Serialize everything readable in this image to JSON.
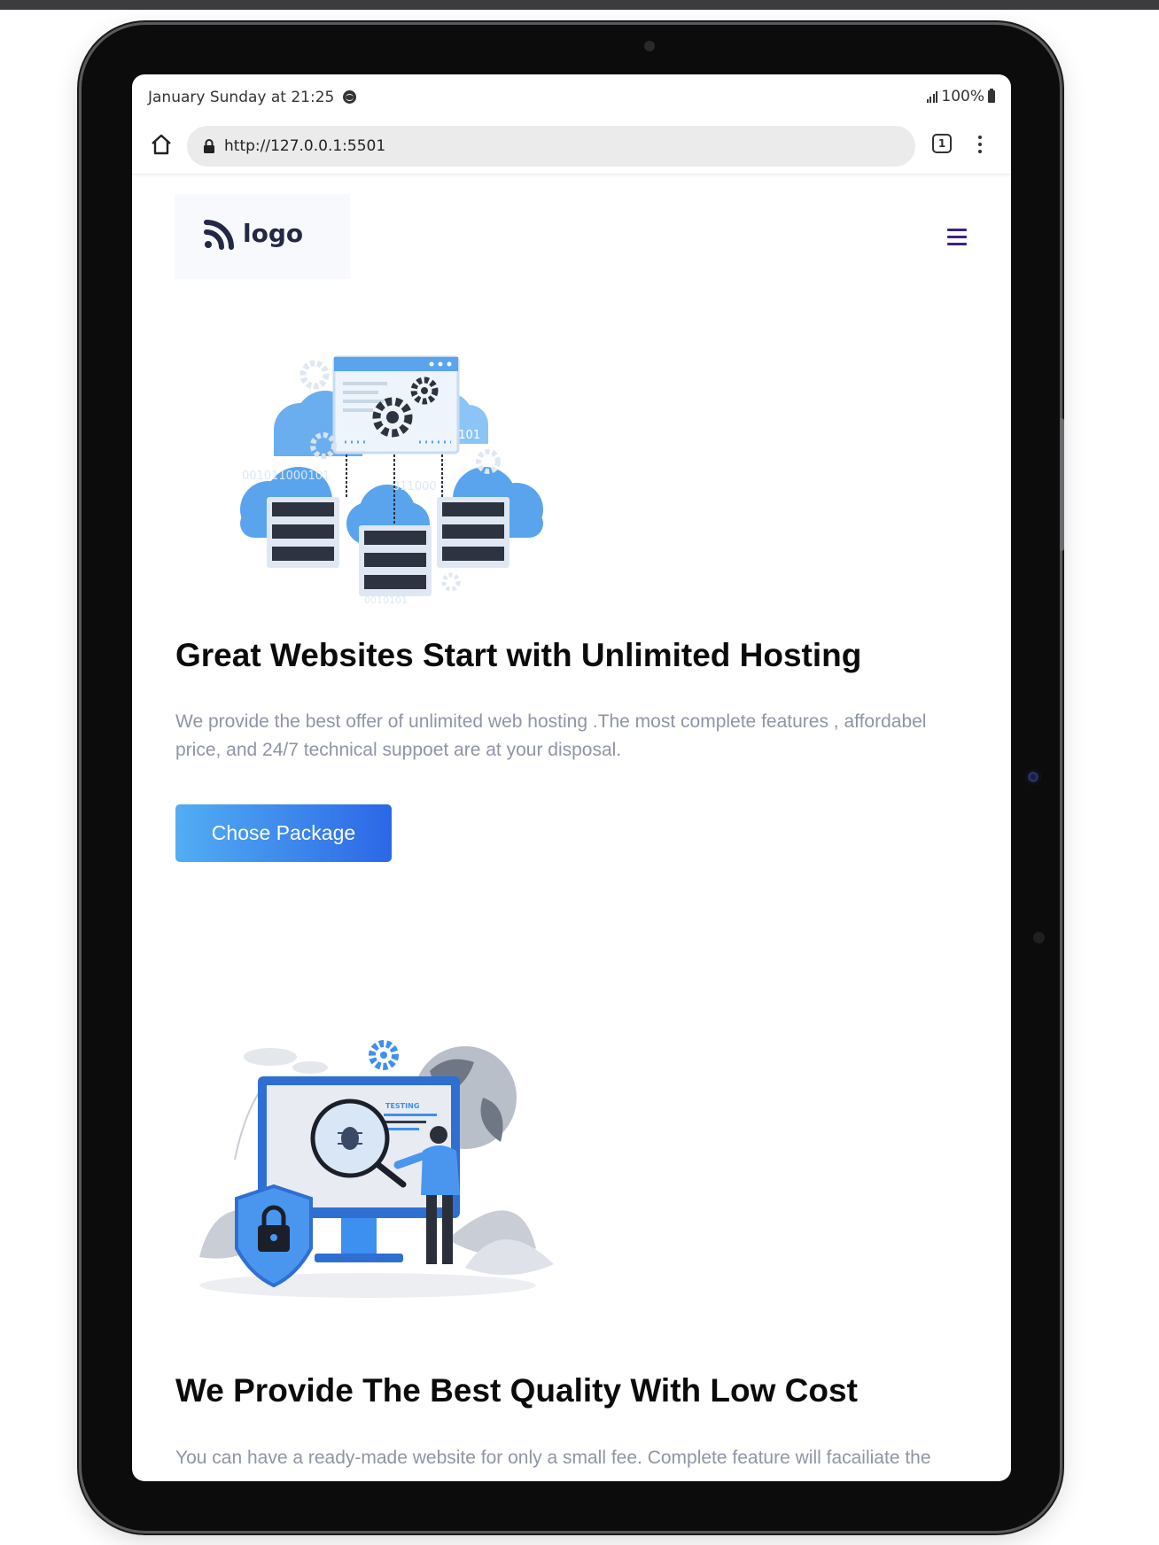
{
  "status_bar": {
    "time_text": "January Sunday at 21:25",
    "battery_text": "100%"
  },
  "browser": {
    "url": "http://127.0.0.1:5501",
    "tab_count": "1"
  },
  "site": {
    "logo_text": "logo",
    "hero": {
      "title": "Great Websites Start with Unlimited Hosting",
      "description": "We provide the best offer of unlimited web hosting .The most complete features , affordabel price, and 24/7 technical suppoet are at your disposal.",
      "button_label": "Chose Package",
      "illustration_labels": [
        "0101",
        "001011000101",
        "011000",
        "0010101"
      ]
    },
    "section2": {
      "illustration_label": "TESTING",
      "title": "We Provide The Best Quality With Low Cost",
      "description": "You can have a ready-made website for only a small fee. Complete feature will facailiate the"
    }
  },
  "colors": {
    "accent_gradient_start": "#52aef3",
    "accent_gradient_end": "#2c67e6",
    "hamburger": "#3c1f8c",
    "body_text": "#8f95a5",
    "heading_text": "#0b0b0b"
  },
  "icons": [
    "home-icon",
    "lock-icon",
    "tabs-icon",
    "more-vertical-icon",
    "hamburger-menu-icon",
    "spotify-icon",
    "signal-icon",
    "battery-icon",
    "logo-mark-icon",
    "gear-icon",
    "bug-icon",
    "padlock-icon",
    "globe-icon"
  ]
}
